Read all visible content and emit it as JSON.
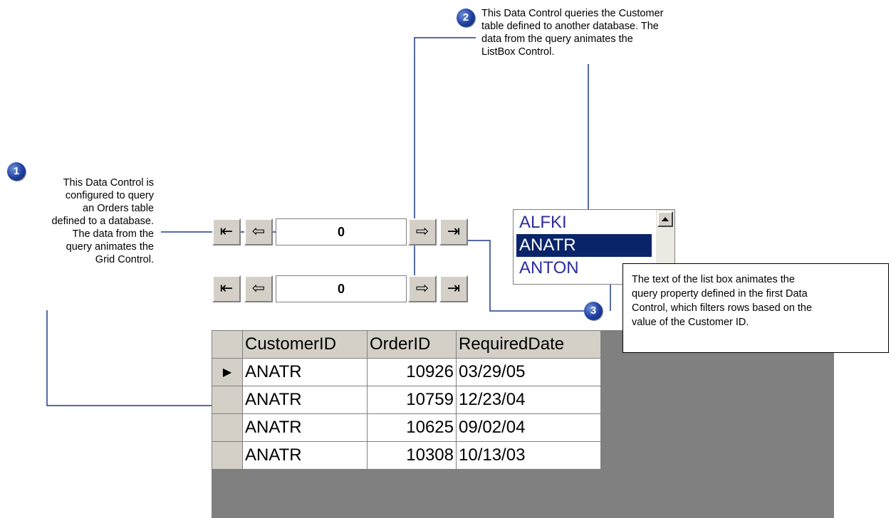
{
  "callouts": {
    "c1": {
      "number": "1",
      "lines": [
        "This Data Control is",
        "configured to query",
        "an Orders table",
        "defined to a database.",
        "The data from the",
        "query animates the",
        "Grid Control."
      ]
    },
    "c2": {
      "number": "2",
      "lines": [
        "This Data Control queries the Customer",
        "table defined to another database.  The",
        "data from the query animates the",
        "ListBox Control."
      ]
    },
    "c3": {
      "number": "3",
      "lines": [
        "The text of the list box animates the",
        "query property defined in the first Data",
        "Control, which filters rows based on the",
        "value of the Customer ID."
      ]
    }
  },
  "data_controls": [
    {
      "value": "0"
    },
    {
      "value": "0"
    }
  ],
  "nav_glyphs": {
    "first": "⇤",
    "prev": "⇦",
    "next": "⇨",
    "last": "⇥"
  },
  "listbox": {
    "items": [
      "ALFKI",
      "ANATR",
      "ANTON"
    ],
    "selected_index": 1
  },
  "grid": {
    "columns": [
      "CustomerID",
      "OrderID",
      "RequiredDate"
    ],
    "rows": [
      {
        "marker": "▶",
        "customer": "ANATR",
        "order": "10926",
        "date": "03/29/05"
      },
      {
        "marker": "",
        "customer": "ANATR",
        "order": "10759",
        "date": "12/23/04"
      },
      {
        "marker": "",
        "customer": "ANATR",
        "order": "10625",
        "date": "09/02/04"
      },
      {
        "marker": "",
        "customer": "ANATR",
        "order": "10308",
        "date": "10/13/03"
      }
    ]
  },
  "colors": {
    "badge": "#1d3e9e",
    "leader_line": "#1f3a8a",
    "selection": "#0a246a",
    "grid_bg": "#808080"
  }
}
